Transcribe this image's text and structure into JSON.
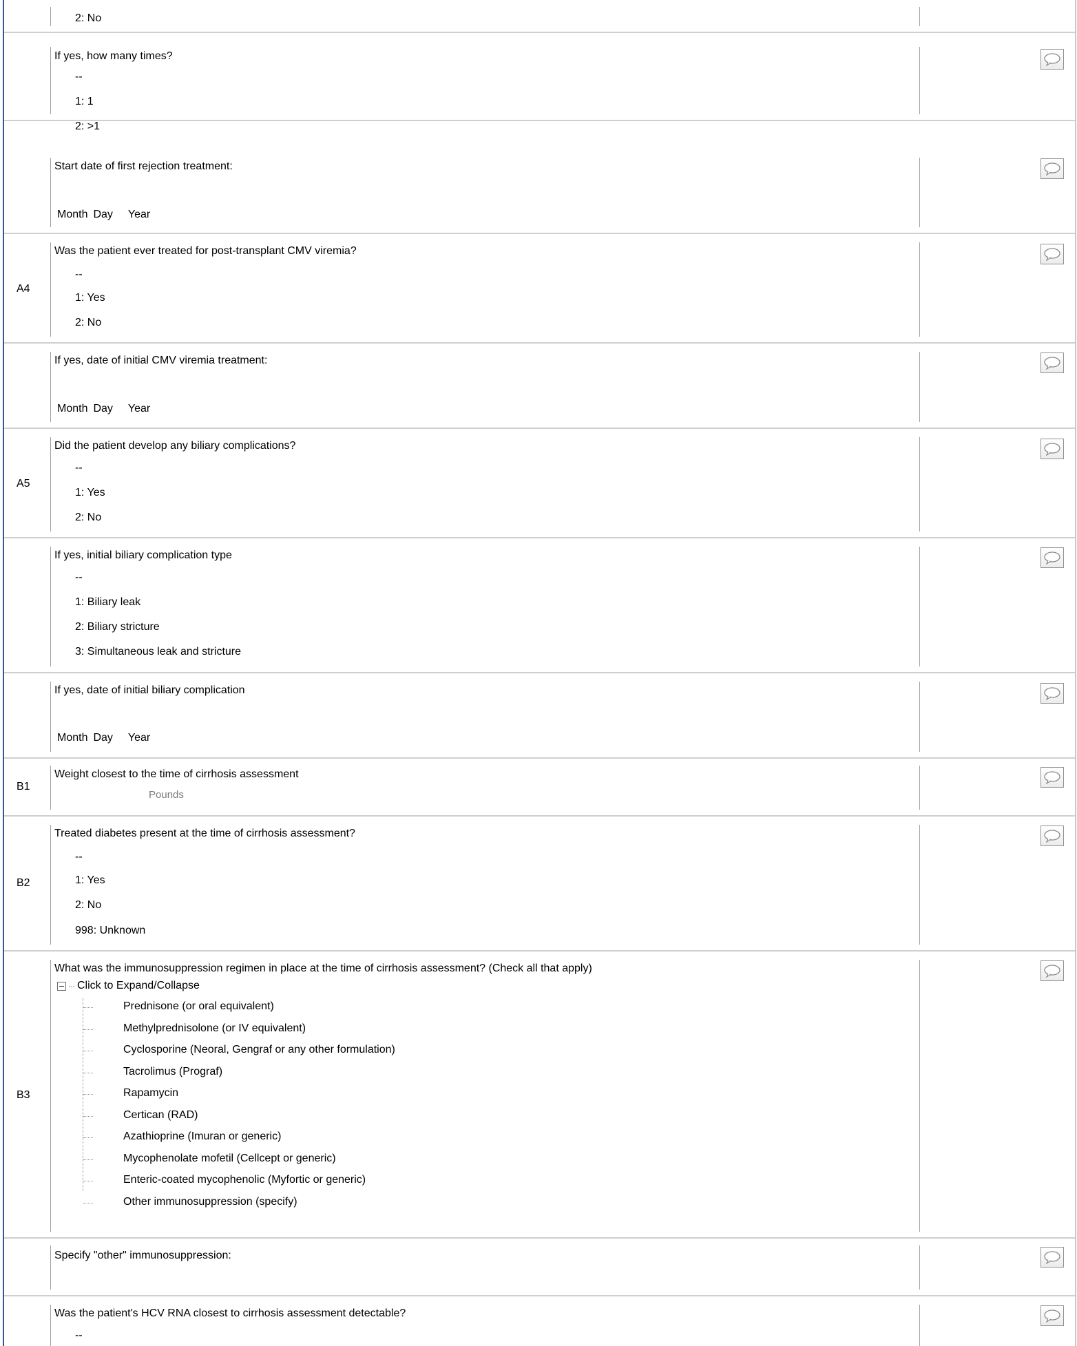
{
  "rows": [
    {
      "id": "",
      "options": [
        "2: No"
      ]
    },
    {
      "id": "",
      "question": "If yes, how many times?",
      "options": [
        "--",
        "1: 1",
        "2: >1"
      ]
    },
    {
      "id": "",
      "question": "Start date of first rejection treatment:",
      "date_labels": [
        "Month",
        "Day",
        "Year"
      ]
    },
    {
      "id": "A4",
      "question": "Was the patient ever treated for post-transplant CMV viremia?",
      "options": [
        "--",
        "1: Yes",
        "2: No"
      ]
    },
    {
      "id": "",
      "question": "If yes, date of initial CMV viremia treatment:",
      "date_labels": [
        "Month",
        "Day",
        "Year"
      ]
    },
    {
      "id": "A5",
      "question": "Did the patient develop any biliary complications?",
      "options": [
        "--",
        "1: Yes",
        "2: No"
      ]
    },
    {
      "id": "",
      "question": "If yes, initial biliary complication type",
      "options": [
        "--",
        "1: Biliary leak",
        "2: Biliary stricture",
        "3: Simultaneous leak and stricture"
      ]
    },
    {
      "id": "",
      "question": "If yes, date of initial biliary complication",
      "date_labels": [
        "Month",
        "Day",
        "Year"
      ]
    },
    {
      "id": "B1",
      "question": "Weight closest to the time of cirrhosis assessment",
      "unit": "Pounds"
    },
    {
      "id": "B2",
      "question": "Treated diabetes present at the time of cirrhosis assessment?",
      "options": [
        "--",
        "1: Yes",
        "2: No",
        "998: Unknown"
      ]
    },
    {
      "id": "B3",
      "question": "What was the immunosuppression regimen in place at the time of cirrhosis assessment? (Check all that apply)",
      "expander_label": "Click to Expand/Collapse",
      "tree_items": [
        "Prednisone (or oral equivalent)",
        "Methylprednisolone (or IV equivalent)",
        "Cyclosporine (Neoral, Gengraf or any other formulation)",
        "Tacrolimus (Prograf)",
        "Rapamycin",
        "Certican (RAD)",
        "Azathioprine (Imuran or generic)",
        "Mycophenolate mofetil (Cellcept or generic)",
        "Enteric-coated mycophenolic (Myfortic or generic)",
        "Other immunosuppression (specify)"
      ]
    },
    {
      "id": "",
      "question": "Specify \"other\" immunosuppression:"
    },
    {
      "id": "",
      "question": "Was the patient's HCV RNA closest to cirrhosis assessment detectable?",
      "options": [
        "--"
      ]
    }
  ],
  "icons": {
    "comment": "speech-bubble-icon",
    "collapse": "minus-box-icon"
  },
  "colors": {
    "left_rule": "#2e5b8c",
    "row_divider": "#cfcfcf"
  }
}
